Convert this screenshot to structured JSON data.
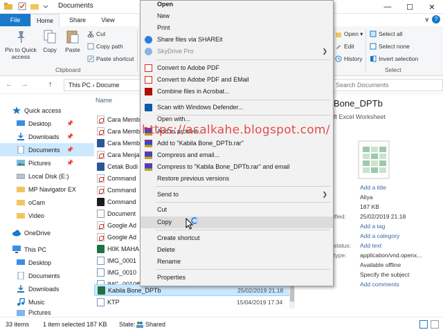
{
  "window": {
    "title": "Documents",
    "controls": [
      "—",
      "☐",
      "✕"
    ]
  },
  "ribbon": {
    "tabs": [
      "File",
      "Home",
      "Share",
      "View"
    ],
    "collapse": "∨",
    "help": "?",
    "clipboard": {
      "pin_label": "Pin to Quick access",
      "copy_label": "Copy",
      "paste_label": "Paste",
      "cut_label": "Cut",
      "copy_path_label": "Copy path",
      "paste_shortcut_label": "Paste shortcut",
      "group_label": "Clipboard"
    },
    "open_group": {
      "open_label": "Open ▾",
      "edit_label": "Edit",
      "history_label": "History"
    },
    "select_group": {
      "select_all_label": "Select all",
      "select_none_label": "Select none",
      "invert_label": "Invert selection",
      "group_label": "Select"
    }
  },
  "address": {
    "path": "This PC  ›  Docume",
    "search_placeholder": "Search Documents",
    "back": "←",
    "forward": "→",
    "up": "↑"
  },
  "navpane": {
    "items": [
      {
        "label": "Quick access"
      },
      {
        "label": "Desktop"
      },
      {
        "label": "Downloads"
      },
      {
        "label": "Documents"
      },
      {
        "label": "Pictures"
      },
      {
        "label": "Local Disk (E:)"
      },
      {
        "label": "MP Navigator EX"
      },
      {
        "label": "oCam"
      },
      {
        "label": "Video"
      },
      {
        "label": "OneDrive"
      },
      {
        "label": "This PC"
      },
      {
        "label": "Desktop"
      },
      {
        "label": "Documents"
      },
      {
        "label": "Downloads"
      },
      {
        "label": "Music"
      },
      {
        "label": "Pictures"
      }
    ]
  },
  "filelist": {
    "col_name": "Name",
    "rows": [
      {
        "name": "Cara Memb"
      },
      {
        "name": "Cara Memb"
      },
      {
        "name": "Cara Memb"
      },
      {
        "name": "Cara Menja"
      },
      {
        "name": "Cetak Budi"
      },
      {
        "name": "Command"
      },
      {
        "name": "Command"
      },
      {
        "name": "Command"
      },
      {
        "name": "Document"
      },
      {
        "name": "Google Ad"
      },
      {
        "name": "Google Ad"
      },
      {
        "name": "H0K MAHA"
      },
      {
        "name": "IMG_0001"
      },
      {
        "name": "IMG_0010"
      },
      {
        "name": "IMG_0010ff"
      },
      {
        "name": "Kabila Bone_DPTb",
        "date": "25/02/2019 21.18"
      },
      {
        "name": "KTP",
        "date": "15/04/2019 17.34"
      }
    ]
  },
  "details": {
    "title": "Bone_DPTb",
    "type": "ft Excel Worksheet",
    "props": [
      {
        "k": "",
        "v": "Add a title"
      },
      {
        "k": "",
        "v": "Aliya"
      },
      {
        "k": "",
        "v": "187 KB"
      },
      {
        "k": "ified:",
        "v": "25/02/2019 21.18"
      },
      {
        "k": "",
        "v": "Add a tag"
      },
      {
        "k": "",
        "v": "Add a category"
      },
      {
        "k": "status:",
        "v": "Add text"
      },
      {
        "k": "type:",
        "v": "application/vnd.openx..."
      },
      {
        "k": "",
        "v": "Available offline"
      },
      {
        "k": "",
        "v": "Specify the subject"
      },
      {
        "k": "",
        "v": "Add comments"
      }
    ]
  },
  "statusbar": {
    "items": "33 items",
    "selected": "1 item selected  187 KB",
    "state": "State:",
    "shared": "Shared"
  },
  "context_menu": {
    "items": [
      {
        "label": "Open"
      },
      {
        "label": "New"
      },
      {
        "label": "Print"
      },
      {
        "label": "Share files via SHAREit"
      },
      {
        "label": "SkyDrive Pro"
      },
      {
        "label": "Convert to Adobe PDF"
      },
      {
        "label": "Convert to Adobe PDF and EMail"
      },
      {
        "label": "Combine files in Acrobat..."
      },
      {
        "label": "Scan with Windows Defender..."
      },
      {
        "label": "Open with..."
      },
      {
        "label": "Add to archive..."
      },
      {
        "label": "Add to \"Kabila Bone_DPTb.rar\""
      },
      {
        "label": "Compress and email..."
      },
      {
        "label": "Compress to \"Kabila Bone_DPTb.rar\" and email"
      },
      {
        "label": "Restore previous versions"
      },
      {
        "label": "Send to"
      },
      {
        "label": "Cut"
      },
      {
        "label": "Copy"
      },
      {
        "label": "Create shortcut"
      },
      {
        "label": "Delete"
      },
      {
        "label": "Rename"
      },
      {
        "label": "Properties"
      }
    ],
    "submenu_arrow": "❯"
  },
  "watermark": "https://asalkahe.blogspot.com/",
  "colors": {
    "accent": "#1979ca",
    "selection": "#cce8ff",
    "menu_bg": "#f2f2f2",
    "watermark": "#e23a3a"
  }
}
